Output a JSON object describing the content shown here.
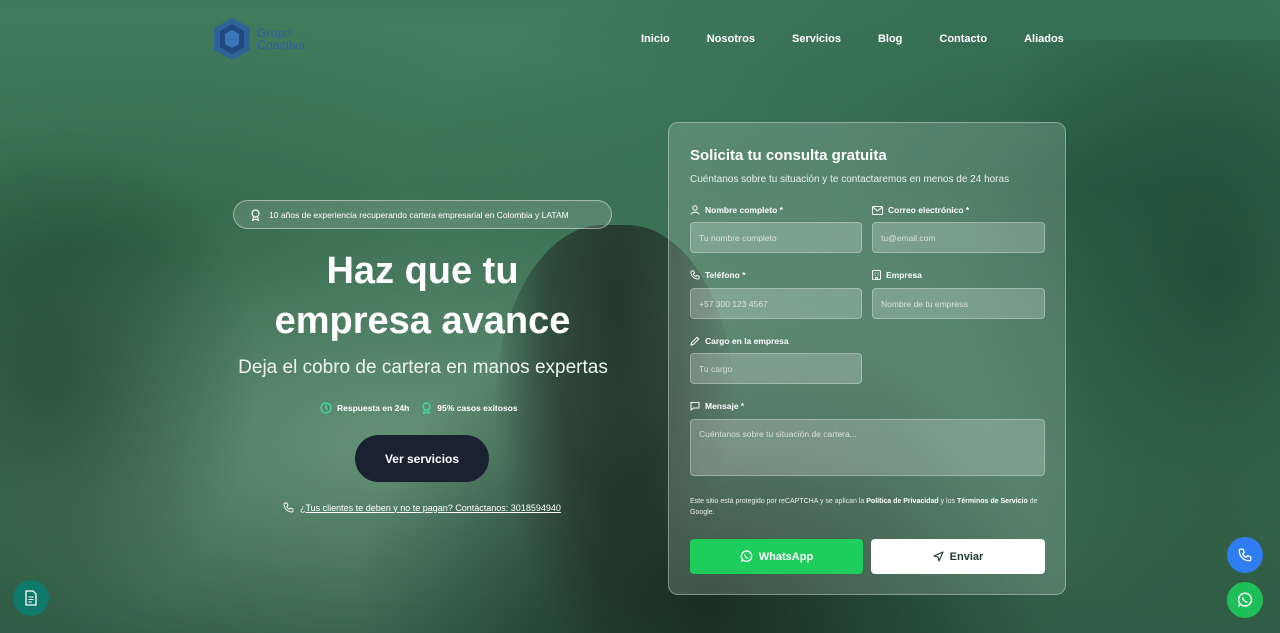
{
  "logo": {
    "line1": "Grupo",
    "line2": "Coactiva"
  },
  "nav": {
    "items": [
      {
        "label": "Inicio"
      },
      {
        "label": "Nosotros"
      },
      {
        "label": "Servicios"
      },
      {
        "label": "Blog"
      },
      {
        "label": "Contacto"
      },
      {
        "label": "Aliados"
      }
    ]
  },
  "hero": {
    "badge": "10 años de experiencia recuperando cartera empresarial en Colombia y LATAM",
    "title_line1": "Haz que tu",
    "title_line2": "empresa avance",
    "subtitle": "Deja el cobro de cartera en manos expertas",
    "stat1": "Respuesta en 24h",
    "stat2": "95% casos exitosos",
    "cta": "Ver servicios",
    "contact_link": "¿Tus clientes te deben y no te pagan? Contáctanos: 3018594940"
  },
  "form": {
    "title": "Solicita tu consulta gratuita",
    "subtitle": "Cuéntanos sobre tu situación y te contactaremos en menos de 24 horas",
    "name_label": "Nombre completo *",
    "name_placeholder": "Tu nombre completo",
    "email_label": "Correo electrónico *",
    "email_placeholder": "tu@email.com",
    "phone_label": "Teléfono *",
    "phone_placeholder": "+57 300 123 4567",
    "company_label": "Empresa",
    "company_placeholder": "Nombre de tu empresa",
    "role_label": "Cargo en la empresa",
    "role_placeholder": "Tu cargo",
    "message_label": "Mensaje *",
    "message_placeholder": "Cuéntanos sobre tu situación de cartera...",
    "recaptcha_pre": "Este sitio está protegido por reCAPTCHA y se aplican la ",
    "recaptcha_privacy": "Política de Privacidad",
    "recaptcha_mid": " y los ",
    "recaptcha_terms": "Términos de Servicio",
    "recaptcha_post": " de Google.",
    "whatsapp_label": "WhatsApp",
    "send_label": "Enviar"
  },
  "colors": {
    "accent_dark": "#1a2232",
    "whatsapp": "#1fcd5c",
    "phone_fab": "#2f7df0",
    "doc_fab": "#0f7a6a",
    "logo_blue": "#2b5fa0",
    "stat_icon": "#3ee0a0"
  },
  "icons": {
    "badge": "award-icon",
    "stat1": "clock-icon",
    "stat2": "award-icon",
    "contact": "phone-icon",
    "name": "user-icon",
    "email": "mail-icon",
    "phone": "phone-icon",
    "company": "building-icon",
    "role": "pencil-icon",
    "message": "message-icon",
    "whatsapp": "whatsapp-icon",
    "send": "send-icon",
    "fab_doc": "document-icon",
    "fab_phone": "phone-icon",
    "fab_wa": "whatsapp-icon"
  }
}
